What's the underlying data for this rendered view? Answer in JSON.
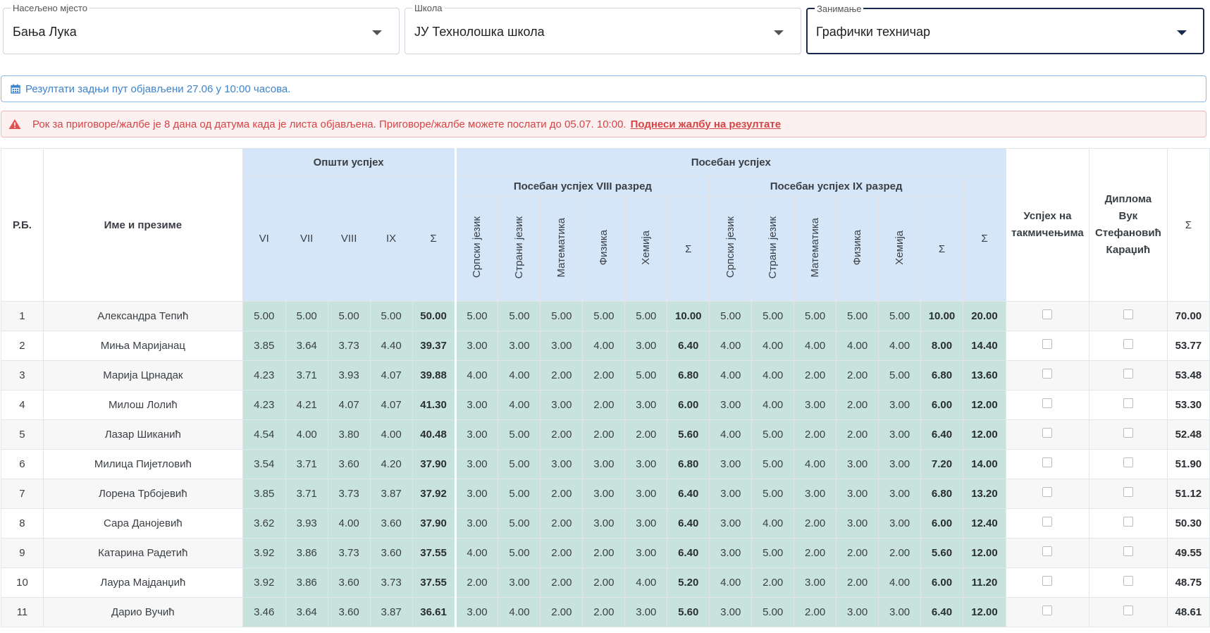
{
  "filters": {
    "place": {
      "label": "Насељено мјесто",
      "value": "Бања Лука"
    },
    "school": {
      "label": "Школа",
      "value": "ЈУ Технолошка школа"
    },
    "profession": {
      "label": "Занимање",
      "value": "Графички техничар"
    }
  },
  "alerts": {
    "info": "Резултати задњи пут објављени 27.06 у 10:00 часова.",
    "danger": "Рок за приговоре/жалбе је 8 дана од датума када је листа објављена. Приговоре/жалбе можете послати до 05.07. 10:00.",
    "danger_link": "Поднеси жалбу на резултате"
  },
  "table": {
    "headers": {
      "rb": "Р.Б.",
      "name": "Име и презиме",
      "general": "Општи успјех",
      "special": "Посебан успјех",
      "special8": "Посебан успјех VIII разред",
      "special9": "Посебан успјех IX разред",
      "grades": [
        "VI",
        "VII",
        "VIII",
        "IX",
        "Σ"
      ],
      "subjects": [
        "Српски језик",
        "Страни језик",
        "Математика",
        "Физика",
        "Хемија",
        "Σ"
      ],
      "special_sum": "Σ",
      "competitions": "Успјех на такмичењима",
      "diploma": "Диплома Вук Стефановић Караџић",
      "total": "Σ"
    },
    "rows": [
      {
        "rb": "1",
        "name": "Александра Тепић",
        "g": [
          "5.00",
          "5.00",
          "5.00",
          "5.00",
          "50.00"
        ],
        "s8": [
          "5.00",
          "5.00",
          "5.00",
          "5.00",
          "5.00",
          "10.00"
        ],
        "s9": [
          "5.00",
          "5.00",
          "5.00",
          "5.00",
          "5.00",
          "10.00"
        ],
        "ss": "20.00",
        "total": "70.00"
      },
      {
        "rb": "2",
        "name": "Миња Маријанац",
        "g": [
          "3.85",
          "3.64",
          "3.73",
          "4.40",
          "39.37"
        ],
        "s8": [
          "3.00",
          "3.00",
          "3.00",
          "4.00",
          "3.00",
          "6.40"
        ],
        "s9": [
          "4.00",
          "4.00",
          "4.00",
          "4.00",
          "4.00",
          "8.00"
        ],
        "ss": "14.40",
        "total": "53.77"
      },
      {
        "rb": "3",
        "name": "Марија Црнадак",
        "g": [
          "4.23",
          "3.71",
          "3.93",
          "4.07",
          "39.88"
        ],
        "s8": [
          "4.00",
          "4.00",
          "2.00",
          "2.00",
          "5.00",
          "6.80"
        ],
        "s9": [
          "4.00",
          "4.00",
          "2.00",
          "2.00",
          "5.00",
          "6.80"
        ],
        "ss": "13.60",
        "total": "53.48"
      },
      {
        "rb": "4",
        "name": "Милош Лолић",
        "g": [
          "4.23",
          "4.21",
          "4.07",
          "4.07",
          "41.30"
        ],
        "s8": [
          "3.00",
          "4.00",
          "3.00",
          "2.00",
          "3.00",
          "6.00"
        ],
        "s9": [
          "3.00",
          "4.00",
          "3.00",
          "2.00",
          "3.00",
          "6.00"
        ],
        "ss": "12.00",
        "total": "53.30"
      },
      {
        "rb": "5",
        "name": "Лазар Шиканић",
        "g": [
          "4.54",
          "4.00",
          "3.80",
          "4.00",
          "40.48"
        ],
        "s8": [
          "3.00",
          "5.00",
          "2.00",
          "2.00",
          "2.00",
          "5.60"
        ],
        "s9": [
          "4.00",
          "5.00",
          "2.00",
          "2.00",
          "3.00",
          "6.40"
        ],
        "ss": "12.00",
        "total": "52.48"
      },
      {
        "rb": "6",
        "name": "Милица Пијетловић",
        "g": [
          "3.54",
          "3.71",
          "3.60",
          "4.20",
          "37.90"
        ],
        "s8": [
          "3.00",
          "5.00",
          "3.00",
          "3.00",
          "3.00",
          "6.80"
        ],
        "s9": [
          "3.00",
          "5.00",
          "4.00",
          "3.00",
          "3.00",
          "7.20"
        ],
        "ss": "14.00",
        "total": "51.90"
      },
      {
        "rb": "7",
        "name": "Лорена Трбојевић",
        "g": [
          "3.85",
          "3.71",
          "3.73",
          "3.87",
          "37.92"
        ],
        "s8": [
          "3.00",
          "5.00",
          "2.00",
          "3.00",
          "3.00",
          "6.40"
        ],
        "s9": [
          "3.00",
          "5.00",
          "3.00",
          "3.00",
          "3.00",
          "6.80"
        ],
        "ss": "13.20",
        "total": "51.12"
      },
      {
        "rb": "8",
        "name": "Сара Данојевић",
        "g": [
          "3.62",
          "3.93",
          "4.00",
          "3.60",
          "37.90"
        ],
        "s8": [
          "3.00",
          "5.00",
          "2.00",
          "3.00",
          "3.00",
          "6.40"
        ],
        "s9": [
          "3.00",
          "4.00",
          "2.00",
          "3.00",
          "3.00",
          "6.00"
        ],
        "ss": "12.40",
        "total": "50.30"
      },
      {
        "rb": "9",
        "name": "Катарина Радетић",
        "g": [
          "3.92",
          "3.86",
          "3.73",
          "3.60",
          "37.55"
        ],
        "s8": [
          "4.00",
          "5.00",
          "2.00",
          "2.00",
          "3.00",
          "6.40"
        ],
        "s9": [
          "3.00",
          "5.00",
          "2.00",
          "2.00",
          "2.00",
          "5.60"
        ],
        "ss": "12.00",
        "total": "49.55"
      },
      {
        "rb": "10",
        "name": "Лаура Мајданџић",
        "g": [
          "3.92",
          "3.86",
          "3.60",
          "3.73",
          "37.55"
        ],
        "s8": [
          "2.00",
          "3.00",
          "2.00",
          "2.00",
          "4.00",
          "5.20"
        ],
        "s9": [
          "4.00",
          "2.00",
          "3.00",
          "2.00",
          "4.00",
          "6.00"
        ],
        "ss": "11.20",
        "total": "48.75"
      },
      {
        "rb": "11",
        "name": "Дарио Вучић",
        "g": [
          "3.46",
          "3.64",
          "3.60",
          "3.87",
          "36.61"
        ],
        "s8": [
          "3.00",
          "4.00",
          "2.00",
          "2.00",
          "3.00",
          "5.60"
        ],
        "s9": [
          "3.00",
          "5.00",
          "2.00",
          "3.00",
          "3.00",
          "6.40"
        ],
        "ss": "12.00",
        "total": "48.61"
      }
    ]
  }
}
